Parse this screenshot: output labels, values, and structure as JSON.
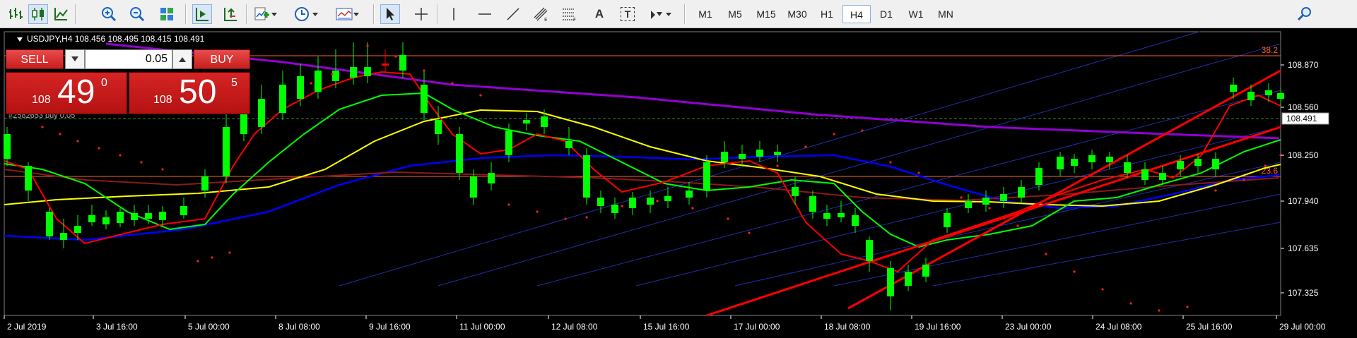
{
  "toolbar": {
    "left_buttons": [
      {
        "name": "bar-chart-button",
        "icon": "bar-chart-icon"
      },
      {
        "name": "candlestick-button",
        "icon": "candlestick-icon"
      },
      {
        "name": "line-chart-button",
        "icon": "line-chart-icon"
      },
      {
        "name": "zoom-in-button",
        "icon": "zoom-in-icon"
      },
      {
        "name": "zoom-out-button",
        "icon": "zoom-out-icon"
      },
      {
        "name": "tile-windows-button",
        "icon": "tile-windows-icon"
      },
      {
        "name": "auto-scroll-button",
        "icon": "auto-scroll-icon"
      },
      {
        "name": "chart-shift-button",
        "icon": "chart-shift-icon"
      },
      {
        "name": "indicators-button",
        "icon": "indicators-icon"
      },
      {
        "name": "periods-button",
        "icon": "clock-icon"
      },
      {
        "name": "templates-button",
        "icon": "templates-icon"
      },
      {
        "name": "cursor-button",
        "icon": "cursor-icon"
      },
      {
        "name": "crosshair-button",
        "icon": "crosshair-icon"
      },
      {
        "name": "vertical-line-button",
        "icon": "vertical-line-icon"
      },
      {
        "name": "horizontal-line-button",
        "icon": "horizontal-line-icon"
      },
      {
        "name": "trendline-button",
        "icon": "trendline-icon"
      },
      {
        "name": "equidistant-channel-button",
        "icon": "equidistant-channel-icon"
      },
      {
        "name": "fibonacci-button",
        "icon": "fibonacci-icon"
      },
      {
        "name": "text-button",
        "icon": "text-icon"
      },
      {
        "name": "text-label-button",
        "icon": "text-label-icon"
      },
      {
        "name": "arrows-button",
        "icon": "arrows-icon"
      }
    ],
    "text_tool_label": "A",
    "text_label_tool_label": "T",
    "timeframes": [
      "M1",
      "M5",
      "M15",
      "M30",
      "H1",
      "H4",
      "D1",
      "W1",
      "MN"
    ],
    "active_timeframe": "H4",
    "search_icon": "search-icon"
  },
  "chart": {
    "symbol_line": "USDJPY,H4  108.456 108.495 108.415 108.491",
    "bid_price": "108.491",
    "price_ticks": [
      "108.870",
      "108.560",
      "108.250",
      "107.940",
      "107.635",
      "107.325"
    ],
    "time_ticks": [
      "2 Jul 2019",
      "3 Jul 16:00",
      "5 Jul 00:00",
      "8 Jul 08:00",
      "9 Jul 16:00",
      "11 Jul 00:00",
      "12 Jul 08:00",
      "15 Jul 16:00",
      "17 Jul 00:00",
      "18 Jul 08:00",
      "19 Jul 16:00",
      "23 Jul 00:00",
      "24 Jul 08:00",
      "25 Jul 16:00",
      "29 Jul 00:00"
    ],
    "fibo_levels": [
      "38.2",
      "23.6"
    ],
    "order_line_label": "#2582653 buy 0.05",
    "colors": {
      "bull": "#00ff00",
      "bear": "#ff0000",
      "ma_fast": "#ff0000",
      "ma_mid": "#00ff00",
      "ma_yellow": "#ffff00",
      "ma_blue": "#0000ff",
      "ma_purple": "#9400d3",
      "fibo": "#ff6020",
      "fan": "#1f2fa8",
      "sar": "#ff2020"
    }
  },
  "trade_panel": {
    "sell_label": "SELL",
    "buy_label": "BUY",
    "lot_value": "0.05",
    "sell_price": {
      "small": "108",
      "big": "49",
      "sup": "0"
    },
    "buy_price": {
      "small": "108",
      "big": "50",
      "sup": "5"
    }
  }
}
